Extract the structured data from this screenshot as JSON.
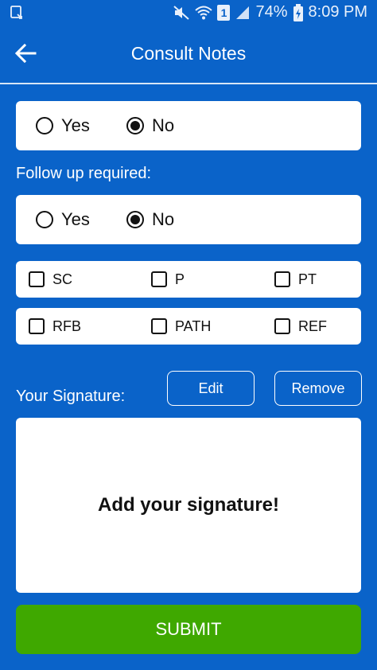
{
  "status_bar": {
    "battery": "74%",
    "time": "8:09 PM",
    "sim_slot": "1"
  },
  "header": {
    "title": "Consult Notes"
  },
  "question_1": {
    "options": [
      {
        "label": "Yes",
        "selected": false
      },
      {
        "label": "No",
        "selected": true
      }
    ]
  },
  "follow_up": {
    "label": "Follow up required:",
    "options": [
      {
        "label": "Yes",
        "selected": false
      },
      {
        "label": "No",
        "selected": true
      }
    ]
  },
  "checkboxes": {
    "row_1": [
      {
        "label": "SC",
        "checked": false
      },
      {
        "label": "P",
        "checked": false
      },
      {
        "label": "PT",
        "checked": false
      }
    ],
    "row_2": [
      {
        "label": "RFB",
        "checked": false
      },
      {
        "label": "PATH",
        "checked": false
      },
      {
        "label": "REF",
        "checked": false
      }
    ]
  },
  "signature": {
    "label": "Your Signature:",
    "edit_label": "Edit",
    "remove_label": "Remove",
    "placeholder": "Add your signature!"
  },
  "submit_label": "SUBMIT",
  "colors": {
    "background": "#0a63c9",
    "submit": "#3fa800",
    "card": "#ffffff"
  }
}
